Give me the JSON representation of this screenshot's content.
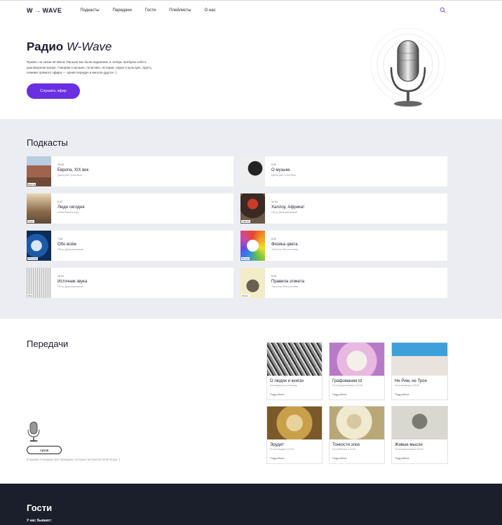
{
  "header": {
    "logo_left": "W",
    "logo_arrow": "→",
    "logo_right": "WAVE",
    "nav": [
      "Подкасты",
      "Передачи",
      "Гости",
      "Плейлисты",
      "О нас"
    ]
  },
  "hero": {
    "title_main": "Радио",
    "title_italic": "W-Wave",
    "text": "Привет, на связи W-Wave! Раньше мы были изданием, а теперь пробуем себя в разговорном жанре. Говорим о музыке, политике, истории, науке и культуре. Здесь, помимо прямого эфира — архив передач и многое другое :)",
    "listen_button": "Слушать эфир"
  },
  "podcasts": {
    "title": "Подкасты",
    "items": [
      {
        "date": "25.03",
        "title": "Европа, XIX век",
        "author": "Дмитрий Гутенберг",
        "tag": "Европа",
        "color": "#8a5a45"
      },
      {
        "date": "9.02",
        "title": "О музыке",
        "author": "Дмитрий Гутенберг",
        "tag": "",
        "color": "#d9d9d9"
      },
      {
        "date": "8.02",
        "title": "Люди сегодня",
        "author": "Лика Васильева",
        "tag": "Люди",
        "color": "#7a6a52"
      },
      {
        "date": "14.04",
        "title": "Халлоу, Африка!",
        "author": "Пётр Дмитриевский",
        "tag": "Африка",
        "color": "#5a3a30"
      },
      {
        "date": "7.08",
        "title": "Обо всём",
        "author": "Пётр Дмитриевский",
        "tag": "Обо всём",
        "color": "#2d4a7a"
      },
      {
        "date": "8.02",
        "title": "Физика цвета",
        "author": "Татьяна Флетчелева",
        "tag": "Физика",
        "color": "#f2e6d0"
      },
      {
        "date": "18.04",
        "title": "Источник звука",
        "author": "Пётр Дмитриевский",
        "tag": "Звук",
        "color": "#d9d9d9"
      },
      {
        "date": "8.03",
        "title": "Правила этикета",
        "author": "Татьяна Флетчелева",
        "tag": "Этикет",
        "color": "#f3ecc8"
      }
    ]
  },
  "shows": {
    "title": "Передачи",
    "archive_button": "Архив",
    "archive_note": "В архиве попадают все передачи, которые вы пропустили! Enjoy :)",
    "items": [
      {
        "title": "О людях и книгах",
        "sub": "Еженедельно в пятницу",
        "more": "Подробнее",
        "color": "#5a5a5a"
      },
      {
        "title": "Графомания td",
        "sub": "По понедельникам в 10:00",
        "more": "Подробнее",
        "color": "#e8b8e0"
      },
      {
        "title": "Не Рим, не Троя",
        "sub": "По вторникам в 19:00",
        "more": "Подробнее",
        "color": "#3da0d8"
      },
      {
        "title": "Эрудит",
        "sub": "По пятницам в 19:00",
        "more": "Подробнее",
        "color": "#c9a04a"
      },
      {
        "title": "Тонкости эпох",
        "sub": "По субботам в 10:00",
        "more": "Подробнее",
        "color": "#e8e0b8"
      },
      {
        "title": "Живые мысли",
        "sub": "По воскресеньям в 20:00",
        "more": "Подробнее",
        "color": "#c9c9c0"
      }
    ]
  },
  "guests": {
    "title": "Гости",
    "sub": "У нас бывают:"
  },
  "icons": {
    "search": "search-icon",
    "mic": "microphone-icon",
    "arrow": "arrow-right-icon"
  }
}
